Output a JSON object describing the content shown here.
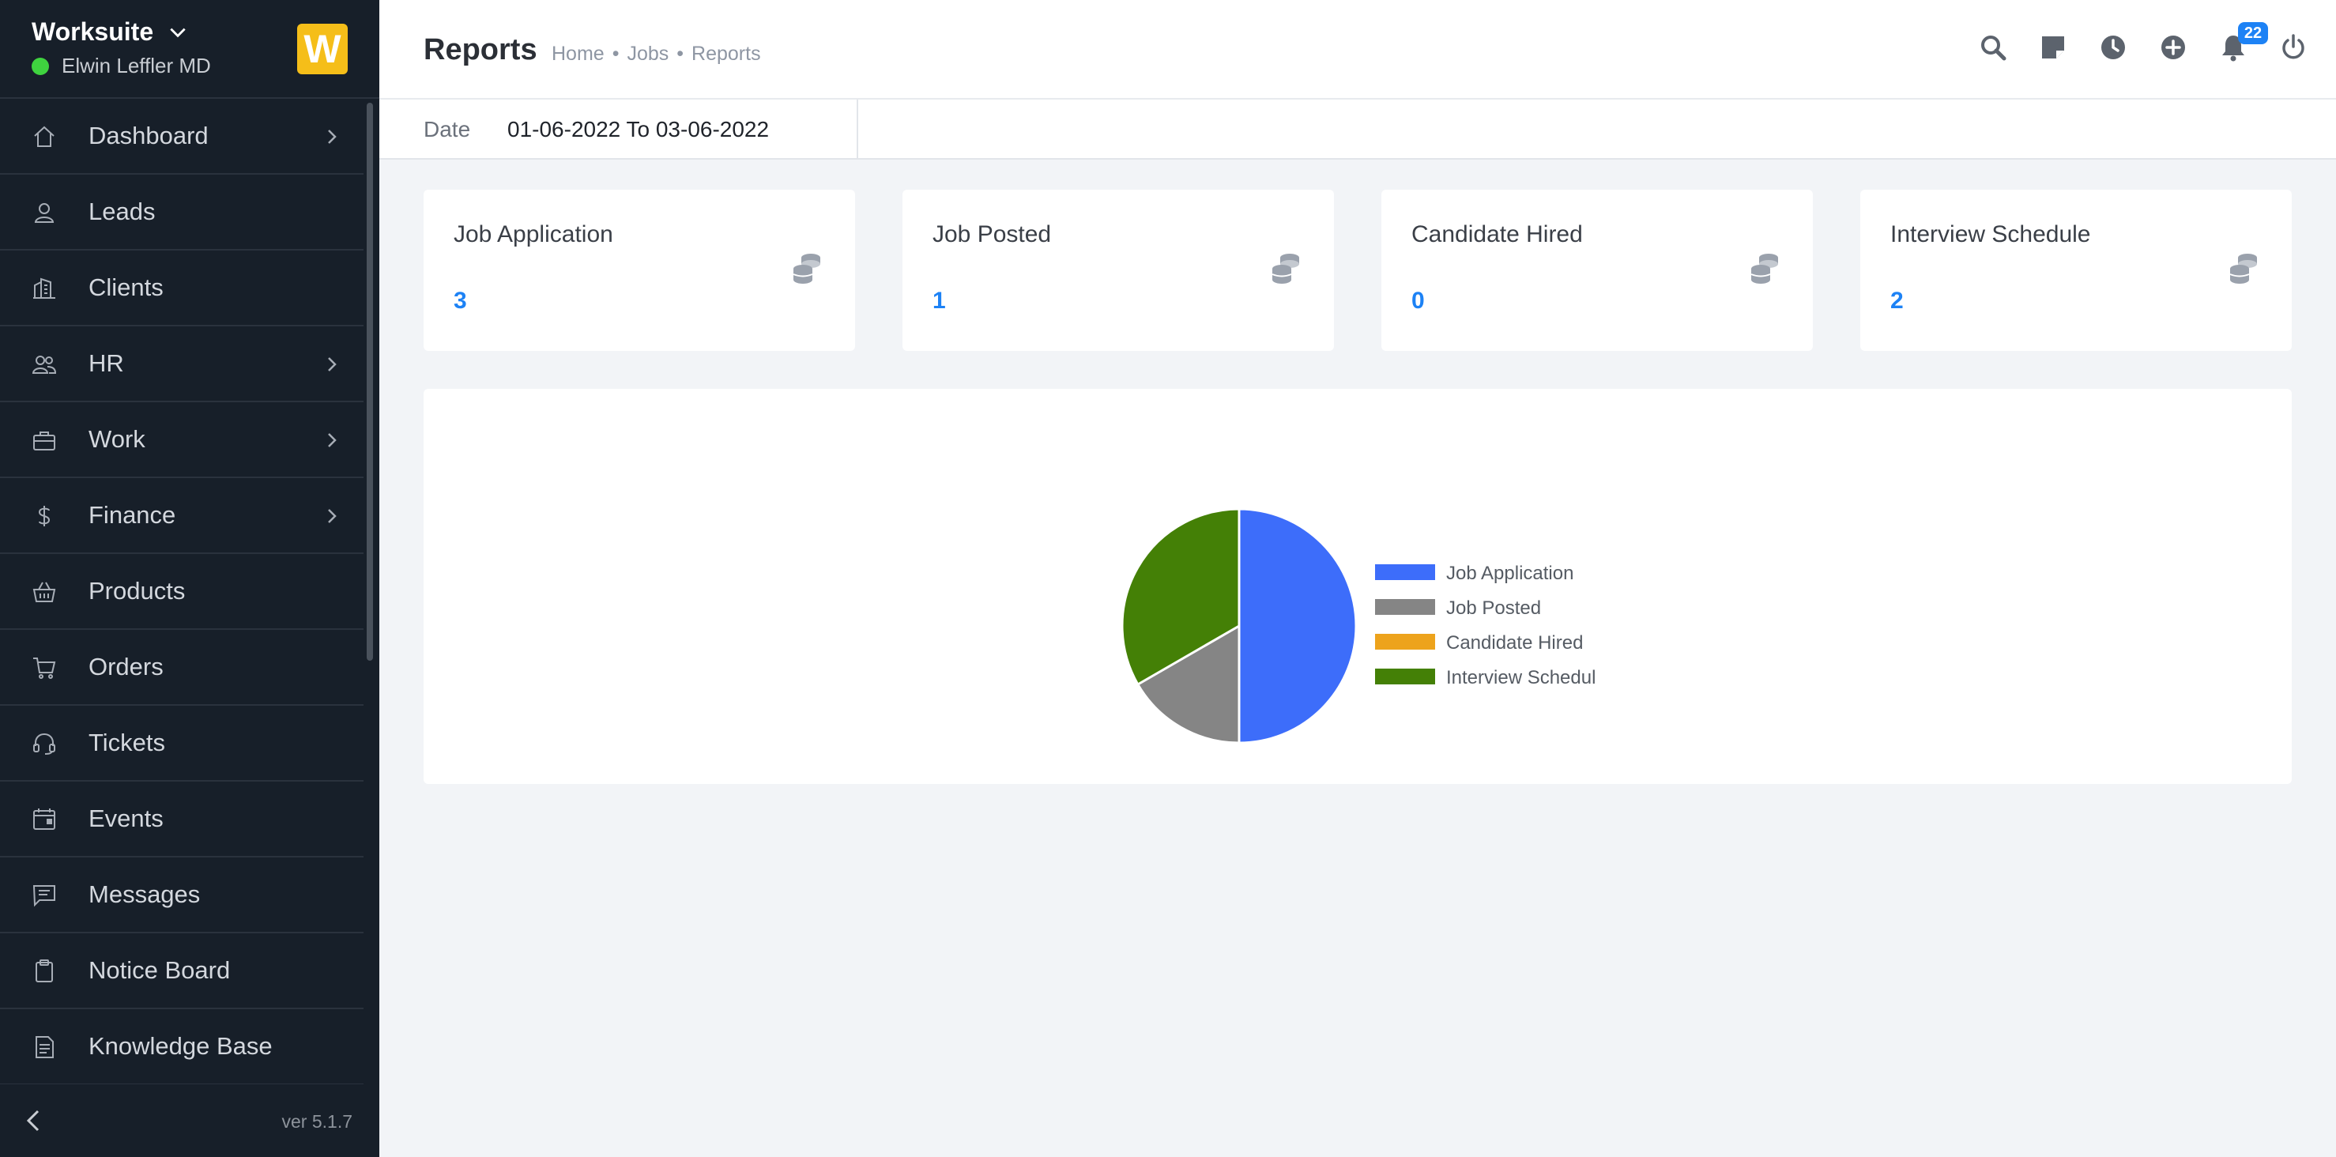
{
  "sidebar": {
    "brand": "Worksuite",
    "user": "Elwin Leffler MD",
    "logo_letter": "W",
    "version": "ver 5.1.7",
    "items": [
      {
        "label": "Dashboard",
        "icon": "home-icon",
        "has_submenu": true
      },
      {
        "label": "Leads",
        "icon": "user-icon",
        "has_submenu": false
      },
      {
        "label": "Clients",
        "icon": "building-icon",
        "has_submenu": false
      },
      {
        "label": "HR",
        "icon": "people-icon",
        "has_submenu": true
      },
      {
        "label": "Work",
        "icon": "briefcase-icon",
        "has_submenu": true
      },
      {
        "label": "Finance",
        "icon": "dollar-icon",
        "has_submenu": true
      },
      {
        "label": "Products",
        "icon": "basket-icon",
        "has_submenu": false
      },
      {
        "label": "Orders",
        "icon": "cart-icon",
        "has_submenu": false
      },
      {
        "label": "Tickets",
        "icon": "headset-icon",
        "has_submenu": false
      },
      {
        "label": "Events",
        "icon": "calendar-icon",
        "has_submenu": false
      },
      {
        "label": "Messages",
        "icon": "message-icon",
        "has_submenu": false
      },
      {
        "label": "Notice Board",
        "icon": "clipboard-icon",
        "has_submenu": false
      },
      {
        "label": "Knowledge Base",
        "icon": "document-icon",
        "has_submenu": false
      }
    ]
  },
  "header": {
    "title": "Reports",
    "breadcrumb": [
      "Home",
      "Jobs",
      "Reports"
    ],
    "breadcrumb_sep": "•",
    "notification_count": "22"
  },
  "filter": {
    "date_label": "Date",
    "date_value": "01-06-2022 To 03-06-2022"
  },
  "cards": [
    {
      "title": "Job Application",
      "value": "3"
    },
    {
      "title": "Job Posted",
      "value": "1"
    },
    {
      "title": "Candidate Hired",
      "value": "0"
    },
    {
      "title": "Interview Schedule",
      "value": "2"
    }
  ],
  "colors": {
    "accent": "#1d82f5",
    "sidebar_bg": "#171f29",
    "logo_bg": "#f5be19",
    "online": "#3fd33f"
  },
  "chart_data": {
    "type": "pie",
    "categories": [
      "Job Application",
      "Job Posted",
      "Candidate Hired",
      "Interview Schedule"
    ],
    "legend_display": [
      "Job Application",
      "Job Posted",
      "Candidate Hired",
      "Interview Schedul"
    ],
    "values": [
      3,
      1,
      0,
      2
    ],
    "colors": [
      "#3d6dfa",
      "#858585",
      "#eda31c",
      "#448006"
    ],
    "legend": "right"
  }
}
